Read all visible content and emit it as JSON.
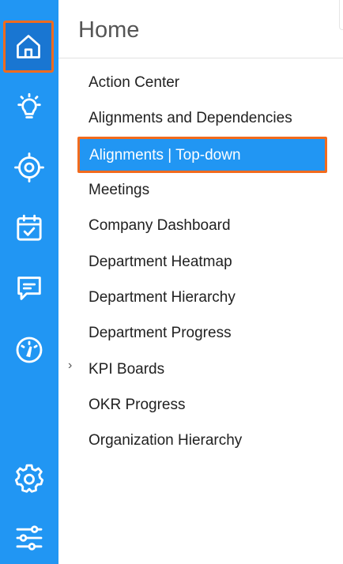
{
  "rail": {
    "items": [
      "home-icon",
      "lightbulb-icon",
      "target-icon",
      "calendar-check-icon",
      "chat-icon",
      "speedometer-icon",
      "settings-icon",
      "sliders-icon"
    ]
  },
  "panel": {
    "title": "Home",
    "items": [
      {
        "label": "Action Center"
      },
      {
        "label": "Alignments and Dependencies"
      },
      {
        "label": "Alignments | Top-down",
        "selected": true
      },
      {
        "label": "Meetings"
      },
      {
        "label": "Company Dashboard"
      },
      {
        "label": "Department Heatmap"
      },
      {
        "label": "Department Hierarchy"
      },
      {
        "label": "Department Progress"
      },
      {
        "label": "KPI Boards",
        "expandable": true
      },
      {
        "label": "OKR Progress"
      },
      {
        "label": "Organization Hierarchy"
      }
    ],
    "chevron": "›"
  },
  "colors": {
    "rail": "#2196f3",
    "rail_active": "#1976d2",
    "highlight_outline": "#f26b1d",
    "selected_bg": "#2196f3"
  }
}
